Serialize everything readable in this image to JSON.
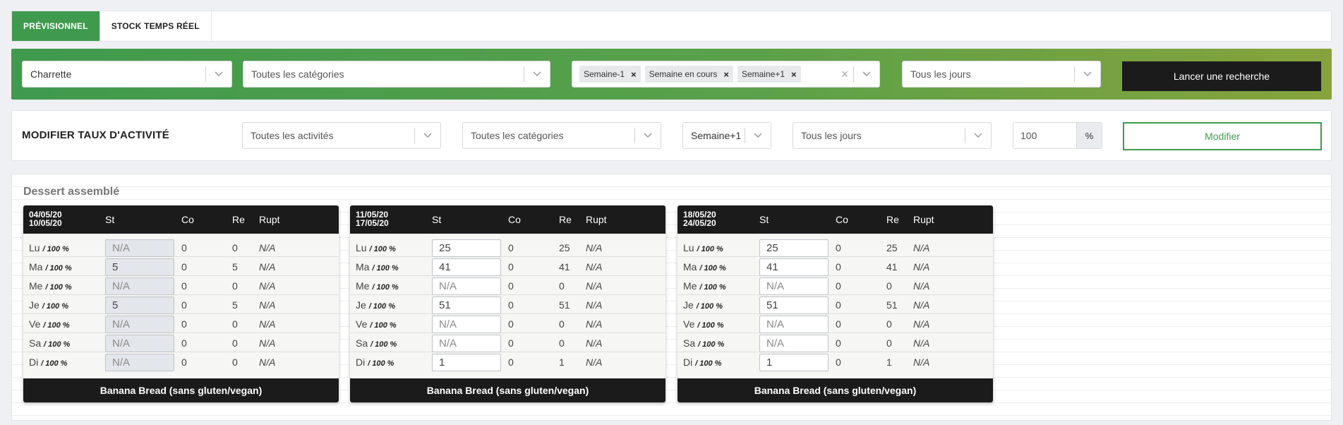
{
  "tabs": [
    {
      "label": "PRÉVISIONNEL",
      "active": true
    },
    {
      "label": "STOCK TEMPS RÉEL",
      "active": false
    }
  ],
  "filters": {
    "site": "Charrette",
    "categories_placeholder": "Toutes les catégories",
    "weeks": [
      "Semaine-1",
      "Semaine en cours",
      "Semaine+1"
    ],
    "days_placeholder": "Tous les jours",
    "search_label": "Lancer une recherche"
  },
  "modifier": {
    "title": "MODIFIER TAUX D'ACTIVITÉ",
    "activities_placeholder": "Toutes les activités",
    "categories_placeholder": "Toutes les catégories",
    "week": "Semaine+1",
    "days_placeholder": "Tous les jours",
    "rate": "100",
    "unit": "%",
    "submit_label": "Modifier"
  },
  "section": {
    "title": "Dessert assemblé",
    "columns": [
      "St",
      "Co",
      "Re",
      "Rupt"
    ],
    "cards": [
      {
        "date_start": "04/05/20",
        "date_end": "10/05/20",
        "readonly": true,
        "product": "Banana Bread (sans gluten/vegan)",
        "rows": [
          {
            "day": "Lu",
            "rate": "/ 100 %",
            "st": "N/A",
            "co": "0",
            "re": "0",
            "rupt": "N/A"
          },
          {
            "day": "Ma",
            "rate": "/ 100 %",
            "st": "5",
            "co": "0",
            "re": "5",
            "rupt": "N/A"
          },
          {
            "day": "Me",
            "rate": "/ 100 %",
            "st": "N/A",
            "co": "0",
            "re": "0",
            "rupt": "N/A"
          },
          {
            "day": "Je",
            "rate": "/ 100 %",
            "st": "5",
            "co": "0",
            "re": "5",
            "rupt": "N/A"
          },
          {
            "day": "Ve",
            "rate": "/ 100 %",
            "st": "N/A",
            "co": "0",
            "re": "0",
            "rupt": "N/A"
          },
          {
            "day": "Sa",
            "rate": "/ 100 %",
            "st": "N/A",
            "co": "0",
            "re": "0",
            "rupt": "N/A"
          },
          {
            "day": "Di",
            "rate": "/ 100 %",
            "st": "N/A",
            "co": "0",
            "re": "0",
            "rupt": "N/A"
          }
        ]
      },
      {
        "date_start": "11/05/20",
        "date_end": "17/05/20",
        "readonly": false,
        "product": "Banana Bread (sans gluten/vegan)",
        "rows": [
          {
            "day": "Lu",
            "rate": "/ 100 %",
            "st": "25",
            "co": "0",
            "re": "25",
            "rupt": "N/A"
          },
          {
            "day": "Ma",
            "rate": "/ 100 %",
            "st": "41",
            "co": "0",
            "re": "41",
            "rupt": "N/A"
          },
          {
            "day": "Me",
            "rate": "/ 100 %",
            "st": "N/A",
            "co": "0",
            "re": "0",
            "rupt": "N/A"
          },
          {
            "day": "Je",
            "rate": "/ 100 %",
            "st": "51",
            "co": "0",
            "re": "51",
            "rupt": "N/A"
          },
          {
            "day": "Ve",
            "rate": "/ 100 %",
            "st": "N/A",
            "co": "0",
            "re": "0",
            "rupt": "N/A"
          },
          {
            "day": "Sa",
            "rate": "/ 100 %",
            "st": "N/A",
            "co": "0",
            "re": "0",
            "rupt": "N/A"
          },
          {
            "day": "Di",
            "rate": "/ 100 %",
            "st": "1",
            "co": "0",
            "re": "1",
            "rupt": "N/A"
          }
        ]
      },
      {
        "date_start": "18/05/20",
        "date_end": "24/05/20",
        "readonly": false,
        "product": "Banana Bread (sans gluten/vegan)",
        "rows": [
          {
            "day": "Lu",
            "rate": "/ 100 %",
            "st": "25",
            "co": "0",
            "re": "25",
            "rupt": "N/A"
          },
          {
            "day": "Ma",
            "rate": "/ 100 %",
            "st": "41",
            "co": "0",
            "re": "41",
            "rupt": "N/A"
          },
          {
            "day": "Me",
            "rate": "/ 100 %",
            "st": "N/A",
            "co": "0",
            "re": "0",
            "rupt": "N/A"
          },
          {
            "day": "Je",
            "rate": "/ 100 %",
            "st": "51",
            "co": "0",
            "re": "51",
            "rupt": "N/A"
          },
          {
            "day": "Ve",
            "rate": "/ 100 %",
            "st": "N/A",
            "co": "0",
            "re": "0",
            "rupt": "N/A"
          },
          {
            "day": "Sa",
            "rate": "/ 100 %",
            "st": "N/A",
            "co": "0",
            "re": "0",
            "rupt": "N/A"
          },
          {
            "day": "Di",
            "rate": "/ 100 %",
            "st": "1",
            "co": "0",
            "re": "1",
            "rupt": "N/A"
          }
        ]
      }
    ]
  }
}
